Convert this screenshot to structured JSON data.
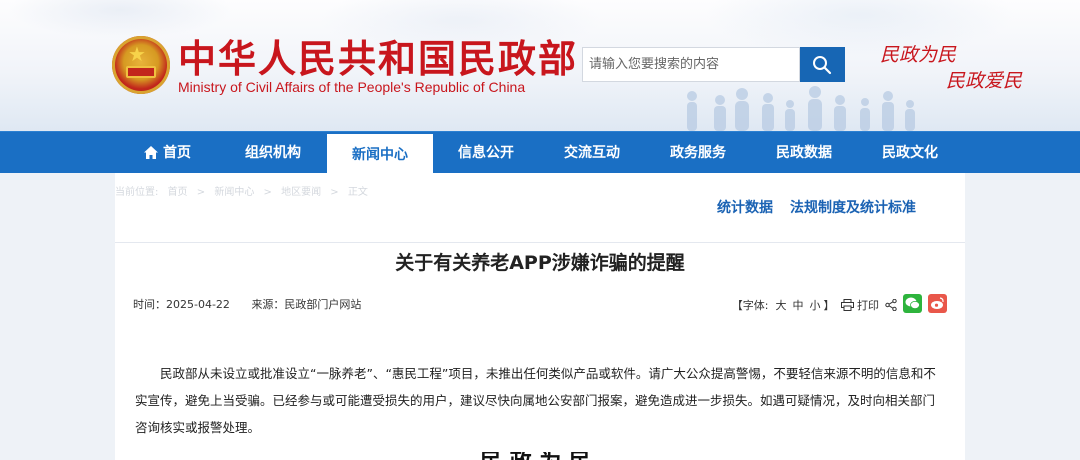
{
  "header": {
    "title_cn": "中华人民共和国民政部",
    "title_en": "Ministry of Civil Affairs of the People's Republic of China",
    "search_placeholder": "请输入您要搜索的内容",
    "slogan_1": "民政为民",
    "slogan_2": "民政爱民"
  },
  "nav": {
    "items": [
      {
        "label": "首页"
      },
      {
        "label": "组织机构"
      },
      {
        "label": "新闻中心"
      },
      {
        "label": "信息公开"
      },
      {
        "label": "交流互动"
      },
      {
        "label": "政务服务"
      },
      {
        "label": "民政数据"
      },
      {
        "label": "民政文化"
      }
    ],
    "active": "新闻中心"
  },
  "breadcrumb": [
    "当前位置:",
    "首页",
    ">",
    "新闻中心",
    ">",
    "地区要闻",
    ">",
    "正文"
  ],
  "category_links": [
    "统计数据",
    "法规制度及统计标准"
  ],
  "article": {
    "title": "关于有关养老APP涉嫌诈骗的提醒",
    "time_label": "时间：2025-04-22",
    "source_label": "来源：民政部门户网站",
    "font_label": "【字体:",
    "font_sizes": [
      "大",
      "中",
      "小"
    ],
    "font_close": "】",
    "print_label": "打印",
    "body": "民政部从未设立或批准设立“一脉养老”、“惠民工程”项目，未推出任何类似产品或软件。请广大公众提高警惕，不要轻信来源不明的信息和不实宣传，避免上当受骗。已经参与或可能遭受损失的用户，建议尽快向属地公安部门报案，避免造成进一步损失。如遇可疑情况，及时向相关部门咨询核实或报警处理。",
    "next_heading": "民 政 为 民"
  },
  "colors": {
    "brand_red": "#c8161d",
    "nav_blue": "#1a6fc4",
    "link_blue": "#1a62b3"
  }
}
